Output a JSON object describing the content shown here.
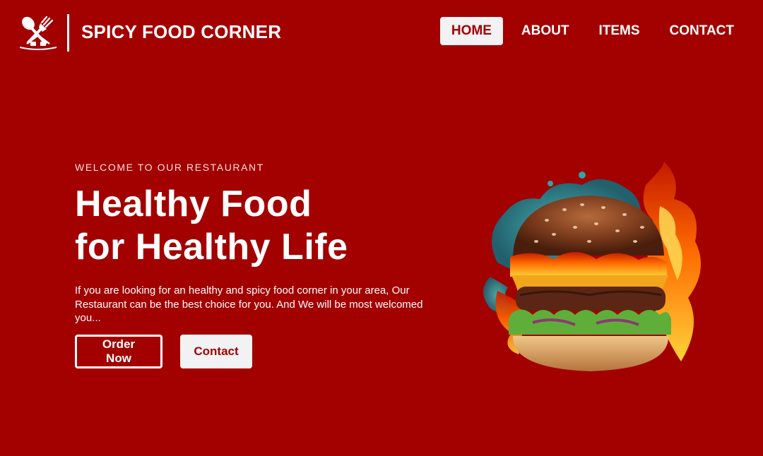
{
  "header": {
    "brand_name": "SPICY FOOD CORNER",
    "logo_icon": "restaurant-utensils-icon",
    "nav": [
      {
        "label": "HOME",
        "active": true
      },
      {
        "label": "ABOUT",
        "active": false
      },
      {
        "label": "ITEMS",
        "active": false
      },
      {
        "label": "CONTACT",
        "active": false
      }
    ]
  },
  "hero": {
    "kicker": "WELCOME TO OUR RESTAURANT",
    "headline_line1": "Healthy Food",
    "headline_line2": "for Healthy Life",
    "description": "If you are looking for an healthy and spicy food corner in your area, Our Restaurant can be the best choice for you. And We will be most welcomed you...",
    "primary_button": "Order Now",
    "secondary_button": "Contact",
    "image": "flaming-burger-image"
  },
  "colors": {
    "background": "#a30000",
    "text": "#ffffff",
    "button_light": "#f2f1f3"
  }
}
